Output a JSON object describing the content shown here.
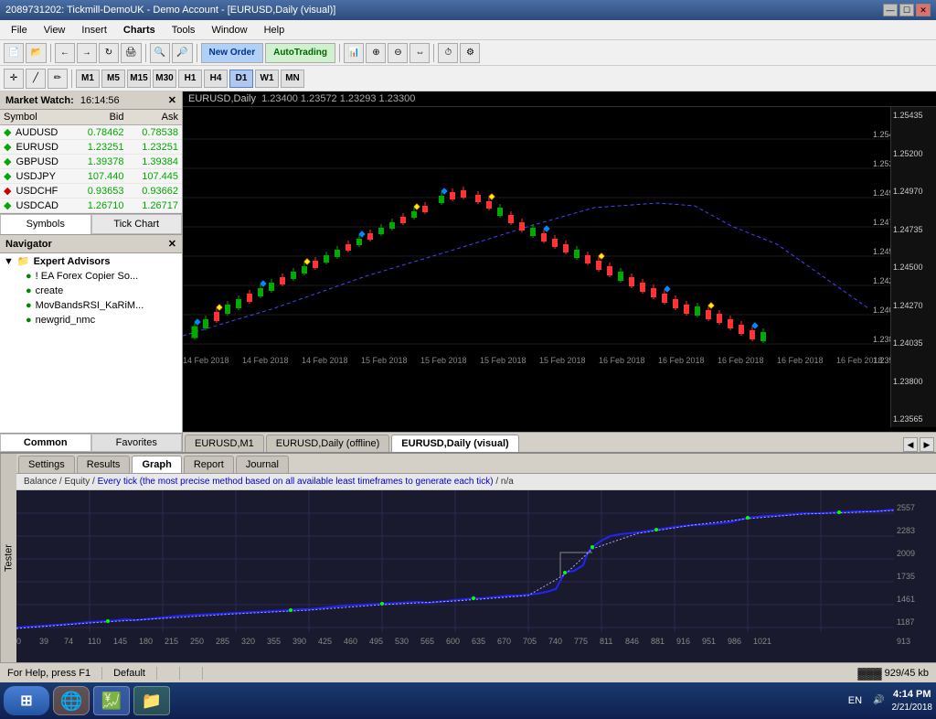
{
  "window": {
    "title": "2089731202: Tickmill-DemoUK - Demo Account - [EURUSD,Daily (visual)]",
    "controls": [
      "—",
      "☐",
      "✕"
    ]
  },
  "menubar": {
    "items": [
      "File",
      "View",
      "Insert",
      "Charts",
      "Tools",
      "Window",
      "Help"
    ]
  },
  "toolbar1": {
    "new_order_label": "New Order",
    "autotrading_label": "AutoTrading"
  },
  "toolbar2": {
    "timeframes": [
      "M1",
      "M5",
      "M15",
      "M30",
      "H1",
      "H4",
      "D1",
      "W1",
      "MN"
    ]
  },
  "market_watch": {
    "title": "Market Watch:",
    "time": "16:14:56",
    "columns": [
      "Symbol",
      "Bid",
      "Ask"
    ],
    "symbols": [
      {
        "name": "AUDUSD",
        "bid": "0.78462",
        "ask": "0.78538",
        "dot": "green"
      },
      {
        "name": "EURUSD",
        "bid": "1.23251",
        "ask": "1.23251",
        "dot": "green"
      },
      {
        "name": "GBPUSD",
        "bid": "1.39378",
        "ask": "1.39384",
        "dot": "green"
      },
      {
        "name": "USDJPY",
        "bid": "107.440",
        "ask": "107.445",
        "dot": "green"
      },
      {
        "name": "USDCHF",
        "bid": "0.93653",
        "ask": "0.93662",
        "dot": "red"
      },
      {
        "name": "USDCAD",
        "bid": "1.26710",
        "ask": "1.26717",
        "dot": "green"
      }
    ],
    "buttons": [
      "Symbols",
      "Tick Chart"
    ]
  },
  "navigator": {
    "title": "Navigator",
    "items": [
      {
        "label": "Expert Advisors",
        "type": "group",
        "level": 0
      },
      {
        "label": "! EA Forex Copier So...",
        "type": "item",
        "level": 1
      },
      {
        "label": "create",
        "type": "item",
        "level": 1
      },
      {
        "label": "MovBandsRSI_KaRiM...",
        "type": "item",
        "level": 1
      },
      {
        "label": "newgrid_nmc",
        "type": "item",
        "level": 1
      }
    ],
    "tabs": [
      "Common",
      "Favorites"
    ]
  },
  "chart": {
    "symbol": "EURUSD,Daily",
    "prices": "1.23400  1.23572  1.23293  1.23300",
    "y_levels": [
      "1.25435",
      "1.25200",
      "1.24970",
      "1.24735",
      "1.24500",
      "1.24270",
      "1.24035",
      "1.23800",
      "1.23565"
    ],
    "x_labels": [
      "14 Feb 2018",
      "14 Feb 2018",
      "14 Feb 2018",
      "15 Feb 2018",
      "15 Feb 2018",
      "15 Feb 2018",
      "15 Feb 2018",
      "16 Feb 2018",
      "16 Feb 2018",
      "16 Feb 2018",
      "16 Feb 2018",
      "16 Feb 2018"
    ],
    "tabs": [
      "EURUSD,M1",
      "EURUSD,Daily (offline)",
      "EURUSD,Daily (visual)"
    ],
    "active_tab": "EURUSD,Daily (visual)"
  },
  "tester": {
    "label": "Tester",
    "description": "Balance / Equity / Every tick (the most precise method based on all available least timeframes to generate each tick) / n/a",
    "tabs": [
      "Settings",
      "Results",
      "Graph",
      "Report",
      "Journal"
    ],
    "active_tab": "Graph",
    "y_axis": [
      "2557",
      "2283",
      "2009",
      "1735",
      "1461",
      "1187",
      "913"
    ],
    "x_axis": [
      "0",
      "39",
      "74",
      "110",
      "145",
      "180",
      "215",
      "250",
      "285",
      "320",
      "355",
      "390",
      "425",
      "460",
      "495",
      "530",
      "565",
      "600",
      "635",
      "670",
      "705",
      "740",
      "775",
      "811",
      "846",
      "881",
      "916",
      "951",
      "986",
      "1021"
    ]
  },
  "statusbar": {
    "help_text": "For Help, press F1",
    "default_label": "Default",
    "memory": "929/45 kb",
    "time": "4:14 PM",
    "date": "2/21/2018",
    "language": "EN"
  },
  "taskbar": {
    "start_label": "⊞",
    "apps": [
      "🌐",
      "💹"
    ]
  }
}
